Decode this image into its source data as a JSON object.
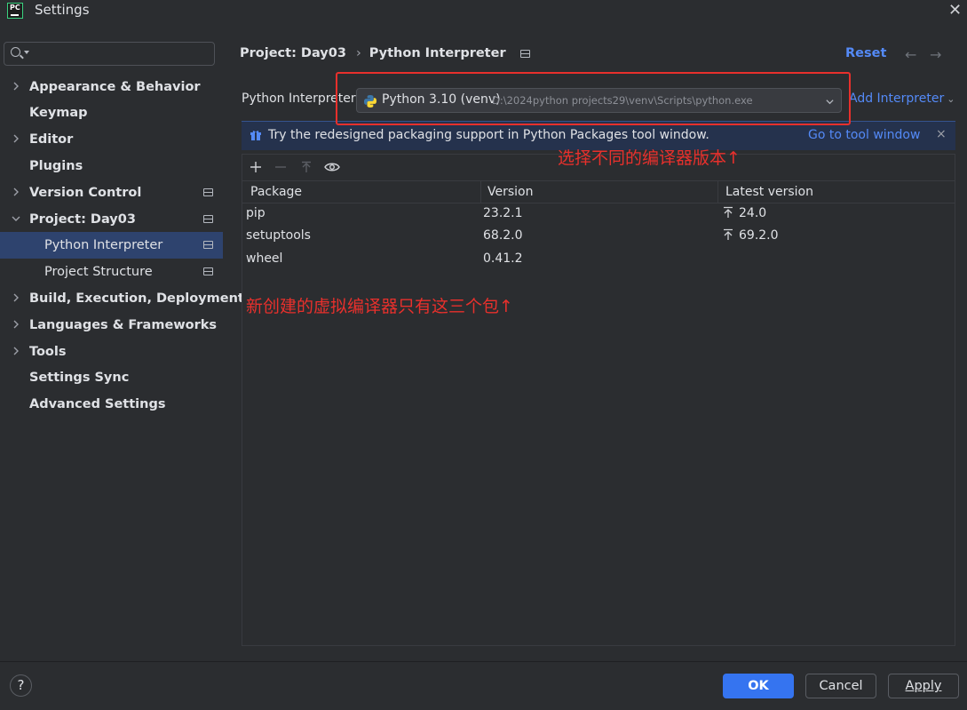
{
  "window": {
    "title": "Settings",
    "logo_text": "PC",
    "close_glyph": "✕"
  },
  "sidebar": {
    "search": {
      "value": "",
      "placeholder": ""
    },
    "items": [
      {
        "label": "Appearance & Behavior",
        "expandable": true,
        "expanded": false
      },
      {
        "label": "Keymap",
        "expandable": false
      },
      {
        "label": "Editor",
        "expandable": true,
        "expanded": false
      },
      {
        "label": "Plugins",
        "expandable": false
      },
      {
        "label": "Version Control",
        "expandable": true,
        "expanded": false,
        "project_icon": true
      },
      {
        "label": "Project: Day03",
        "expandable": true,
        "expanded": true,
        "project_icon": true
      },
      {
        "label": "Python Interpreter",
        "sub": true,
        "selected": true,
        "project_icon": true
      },
      {
        "label": "Project Structure",
        "sub": true,
        "project_icon": true
      },
      {
        "label": "Build, Execution, Deployment",
        "expandable": true,
        "expanded": false
      },
      {
        "label": "Languages & Frameworks",
        "expandable": true,
        "expanded": false
      },
      {
        "label": "Tools",
        "expandable": true,
        "expanded": false
      },
      {
        "label": "Settings Sync",
        "expandable": false
      },
      {
        "label": "Advanced Settings",
        "expandable": false
      }
    ]
  },
  "header": {
    "breadcrumb_parent": "Project: Day03",
    "breadcrumb_sep": "›",
    "breadcrumb_current": "Python Interpreter",
    "reset_label": "Reset",
    "back_glyph": "←",
    "forward_glyph": "→"
  },
  "interpreter": {
    "label": "Python Interpreter:",
    "name": "Python 3.10 (venv)",
    "path": "D:\\2024python projects29\\venv\\Scripts\\python.exe",
    "add_label": "Add Interpreter",
    "add_dropdown_glyph": "⌄"
  },
  "banner": {
    "text": "Try the redesigned packaging support in Python Packages tool window.",
    "link": "Go to tool window",
    "close_glyph": "×"
  },
  "annotations": {
    "select_hint": "选择不同的编译器版本↑",
    "packages_hint": "新创建的虚拟编译器只有这三个包↑"
  },
  "packages": {
    "columns": [
      "Package",
      "Version",
      "Latest version"
    ],
    "rows": [
      {
        "package": "pip",
        "version": "23.2.1",
        "latest": "24.0",
        "upgrade": true
      },
      {
        "package": "setuptools",
        "version": "68.2.0",
        "latest": "69.2.0",
        "upgrade": true
      },
      {
        "package": "wheel",
        "version": "0.41.2",
        "latest": "",
        "upgrade": false
      }
    ]
  },
  "footer": {
    "help_label": "?",
    "ok_label": "OK",
    "cancel_label": "Cancel",
    "apply_label": "Apply"
  },
  "colors": {
    "background": "#2b2d30",
    "accent": "#3574f0",
    "link": "#548af7",
    "selection": "#2e436e",
    "annotation": "#e8302c",
    "banner": "#25324d"
  }
}
